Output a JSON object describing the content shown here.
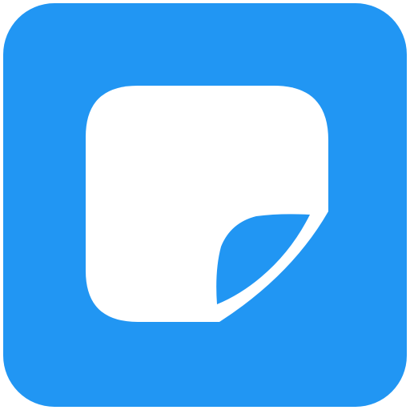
{
  "app_icon": {
    "icon_name": "sticky-note-icon",
    "colors": {
      "background": "#2196F3",
      "foreground": "#FFFFFF"
    }
  }
}
